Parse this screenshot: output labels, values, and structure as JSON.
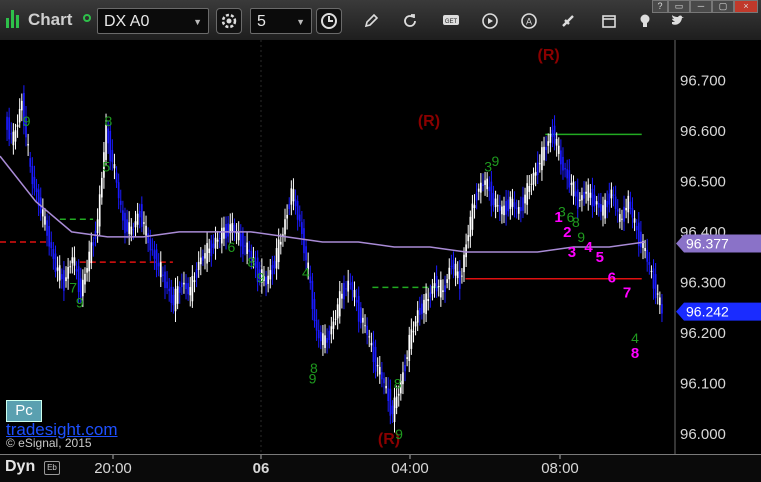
{
  "toolbar": {
    "title": "Chart",
    "symbol": "DX A0",
    "interval": "5",
    "icons": [
      "settings-gear-icon",
      "clock-icon",
      "pencil-icon",
      "refresh-icon",
      "get-icon",
      "play-icon",
      "alert-icon",
      "drawing-tools-icon",
      "calendar-icon",
      "lightbulb-icon",
      "twitter-icon"
    ],
    "window_controls": [
      "?",
      "▭",
      "─",
      "▢",
      "×"
    ]
  },
  "footer": {
    "dyn_label": "Dyn",
    "pc_label": "Pc",
    "brand": "tradesight.com",
    "copyright": "© eSignal, 2015"
  },
  "colors": {
    "up_candle": "#ffffff",
    "down_candle": "#1a1aff",
    "moving_average": "#a98bd6",
    "setup_green": "#1f9a1f",
    "countdown_magenta": "#ff00ff",
    "resistance_green": "#22aa22",
    "resistance_red": "#e01010",
    "r_label": "#8b0000"
  },
  "chart_data": {
    "type": "candlestick",
    "y_ticks": [
      "96.700",
      "96.600",
      "96.500",
      "96.400",
      "96.300",
      "96.200",
      "96.100",
      "96.000"
    ],
    "ylim": [
      95.96,
      96.78
    ],
    "x_ticks": [
      "20:00",
      "06",
      "04:00",
      "08:00"
    ],
    "price_labels": [
      {
        "text": "96.377",
        "value": 96.377,
        "color": "#8a72c8"
      },
      {
        "text": "96.242",
        "value": 96.242,
        "color": "#1a2cff"
      }
    ],
    "close_path": [
      96.62,
      96.58,
      96.66,
      96.52,
      96.46,
      96.4,
      96.33,
      96.3,
      96.35,
      96.28,
      96.35,
      96.42,
      96.6,
      96.52,
      96.42,
      96.4,
      96.44,
      96.38,
      96.34,
      96.3,
      96.26,
      96.3,
      96.28,
      96.34,
      96.36,
      96.38,
      96.4,
      96.41,
      96.38,
      96.36,
      96.32,
      96.3,
      96.34,
      96.4,
      96.48,
      96.42,
      96.32,
      96.2,
      96.18,
      96.22,
      96.28,
      96.3,
      96.24,
      96.2,
      96.14,
      96.1,
      96.04,
      96.1,
      96.18,
      96.24,
      96.26,
      96.3,
      96.28,
      96.34,
      96.3,
      96.4,
      96.48,
      96.5,
      96.46,
      96.44,
      96.46,
      96.44,
      96.48,
      96.52,
      96.56,
      96.6,
      96.54,
      96.5,
      96.46,
      96.48,
      96.46,
      96.44,
      96.48,
      96.42,
      96.46,
      96.4,
      96.36,
      96.3,
      96.24
    ],
    "series": [
      {
        "name": "",
        "values": [
          96.55,
          96.46,
          96.4,
          96.39,
          96.39,
          96.4,
          96.4,
          96.4,
          96.39,
          96.38,
          96.38,
          96.37,
          96.37,
          96.36,
          96.36,
          96.36,
          96.37,
          96.37,
          96.38
        ]
      }
    ],
    "r_labels": [
      {
        "text": "(R)",
        "value": 96.61,
        "t": 0.645
      },
      {
        "text": "(R)",
        "value": 96.74,
        "t": 0.825
      },
      {
        "text": "(R)",
        "value": 95.98,
        "t": 0.585
      }
    ],
    "setup_numbers": [
      {
        "text": "8",
        "t": 0.163,
        "value": 96.61
      },
      {
        "text": "9",
        "t": 0.04,
        "value": 96.61
      },
      {
        "text": "4",
        "t": 0.46,
        "value": 96.31
      },
      {
        "text": "9",
        "t": 0.47,
        "value": 96.1
      },
      {
        "text": "8",
        "t": 0.472,
        "value": 96.12
      },
      {
        "text": "9",
        "t": 0.6,
        "value": 95.99
      },
      {
        "text": "8",
        "t": 0.598,
        "value": 96.09
      },
      {
        "text": "4",
        "t": 0.955,
        "value": 96.18
      },
      {
        "text": "9",
        "t": 0.745,
        "value": 96.53
      },
      {
        "text": "3",
        "t": 0.734,
        "value": 96.52
      },
      {
        "text": "5",
        "t": 0.16,
        "value": 96.52
      },
      {
        "text": "9",
        "t": 0.12,
        "value": 96.25
      },
      {
        "text": "7",
        "t": 0.11,
        "value": 96.28
      },
      {
        "text": "9",
        "t": 0.392,
        "value": 96.3
      },
      {
        "text": "8",
        "t": 0.378,
        "value": 96.33
      },
      {
        "text": "6",
        "t": 0.348,
        "value": 96.36
      },
      {
        "text": "3",
        "t": 0.845,
        "value": 96.43
      },
      {
        "text": "6",
        "t": 0.858,
        "value": 96.42
      },
      {
        "text": "9",
        "t": 0.874,
        "value": 96.38
      },
      {
        "text": "8",
        "t": 0.866,
        "value": 96.41
      }
    ],
    "countdown_numbers": [
      {
        "text": "1",
        "t": 0.84,
        "value": 96.42
      },
      {
        "text": "2",
        "t": 0.853,
        "value": 96.39
      },
      {
        "text": "3",
        "t": 0.86,
        "value": 96.35
      },
      {
        "text": "4",
        "t": 0.885,
        "value": 96.36
      },
      {
        "text": "5",
        "t": 0.902,
        "value": 96.34
      },
      {
        "text": "6",
        "t": 0.92,
        "value": 96.3
      },
      {
        "text": "7",
        "t": 0.943,
        "value": 96.27
      },
      {
        "text": "8",
        "t": 0.955,
        "value": 96.15
      }
    ],
    "levels": [
      {
        "value": 96.593,
        "t0": 0.82,
        "t1": 0.965,
        "color": "#22aa22",
        "dash": false
      },
      {
        "value": 96.307,
        "t0": 0.7,
        "t1": 0.965,
        "color": "#e01010",
        "dash": false
      },
      {
        "value": 96.38,
        "t0": 0.0,
        "t1": 0.07,
        "color": "#e01010",
        "dash": true
      },
      {
        "value": 96.34,
        "t0": 0.12,
        "t1": 0.26,
        "color": "#e01010",
        "dash": true
      },
      {
        "value": 96.425,
        "t0": 0.09,
        "t1": 0.14,
        "color": "#22aa22",
        "dash": true
      },
      {
        "value": 96.29,
        "t0": 0.56,
        "t1": 0.66,
        "color": "#22aa22",
        "dash": true
      }
    ]
  }
}
